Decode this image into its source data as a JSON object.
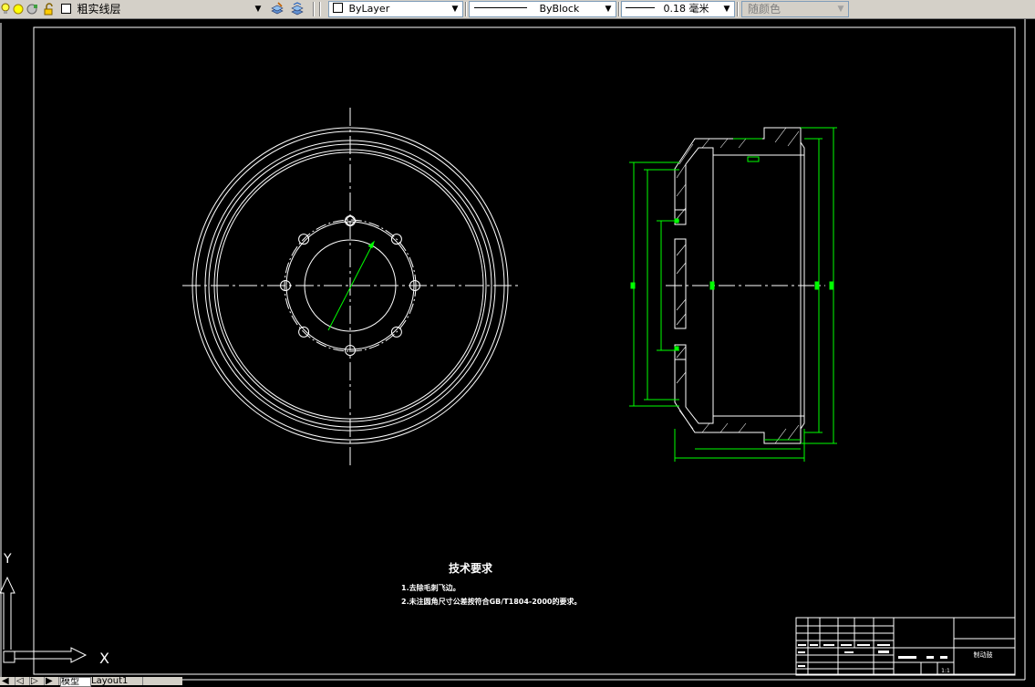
{
  "toolbar": {
    "layer_name": "粗实线层",
    "color_value": "ByLayer",
    "linetype_value": "ByBlock",
    "lineweight_value": "0.18 毫米",
    "plotstyle_value": "随颜色"
  },
  "notes": {
    "heading": "技术要求",
    "items": [
      "1.去除毛刺飞边。",
      "2.未注圆角尺寸公差按符合GB/T1804-2000的要求。"
    ]
  },
  "title_block": {
    "part_name": "制动鼓",
    "scale": "1:1"
  },
  "ucs": {
    "x_label": "X",
    "y_label": "Y"
  },
  "tabs": {
    "model": "模型",
    "layout": "Layout1"
  },
  "colors": {
    "background": "#000000",
    "geometry": "#ffffff",
    "dimensions": "#00ff00",
    "toolbar": "#d4d0c8"
  }
}
